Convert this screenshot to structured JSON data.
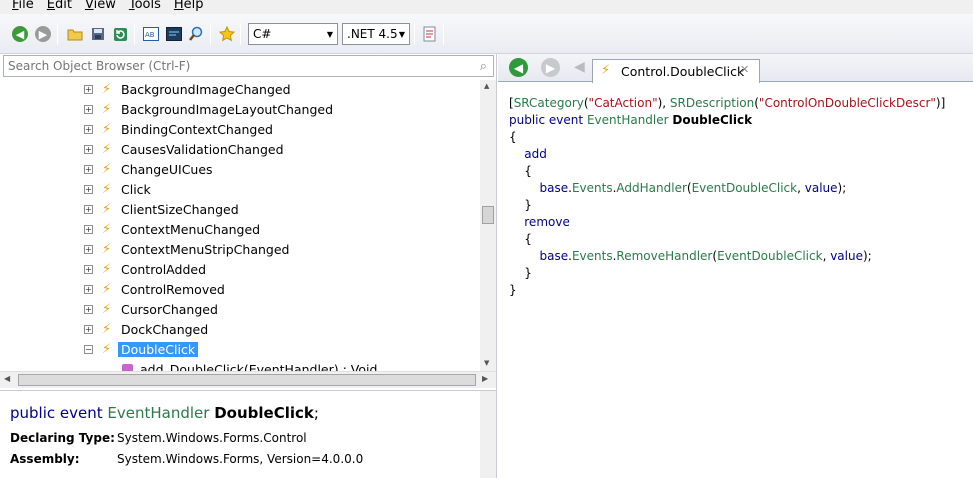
{
  "menu": [
    {
      "label": "File",
      "mnemonic": "F",
      "rest": "ile"
    },
    {
      "label": "Edit",
      "mnemonic": "E",
      "rest": "dit"
    },
    {
      "label": "View",
      "mnemonic": "V",
      "rest": "iew"
    },
    {
      "label": "Tools",
      "mnemonic": "T",
      "rest": "ools"
    },
    {
      "label": "Help",
      "mnemonic": "H",
      "rest": "elp"
    }
  ],
  "toolbar": {
    "language": "C#",
    "framework": ".NET 4.5"
  },
  "search": {
    "placeholder": "Search Object Browser (Ctrl-F)"
  },
  "tree": {
    "items": [
      "BackgroundImageChanged",
      "BackgroundImageLayoutChanged",
      "BindingContextChanged",
      "CausesValidationChanged",
      "ChangeUICues",
      "Click",
      "ClientSizeChanged",
      "ContextMenuChanged",
      "ContextMenuStripChanged",
      "ControlAdded",
      "ControlRemoved",
      "CursorChanged",
      "DockChanged"
    ],
    "selected": "DoubleClick",
    "child": "add_DoubleClick(EventHandler) : Void"
  },
  "info": {
    "sig_kw": "public event",
    "sig_type": "EventHandler",
    "sig_name": "DoubleClick",
    "sig_end": ";",
    "declaring_label": "Declaring Type:",
    "declaring_value": "System.Windows.Forms.Control",
    "assembly_label": "Assembly:",
    "assembly_value": "System.Windows.Forms, Version=4.0.0.0"
  },
  "tab": {
    "label": "Control.DoubleClick"
  },
  "code": {
    "attr_open": "[",
    "attr1": "SRCategory",
    "attr1_arg": "\"CatAction\"",
    "attr2": "SRDescription",
    "attr2_arg": "\"ControlOnDoubleClickDescr\"",
    "decl_kw": "public event",
    "decl_type": "EventHandler",
    "decl_name": "DoubleClick",
    "add": "add",
    "remove": "remove",
    "base": "base",
    "events": "Events",
    "add_handler": "AddHandler",
    "remove_handler": "RemoveHandler",
    "field": "EventDoubleClick",
    "value": "value"
  },
  "colors": {
    "keyword": "#00008b",
    "type": "#2b7a49",
    "string": "#a31515",
    "selection": "#3399ff",
    "event_icon": "#e8a51b"
  }
}
